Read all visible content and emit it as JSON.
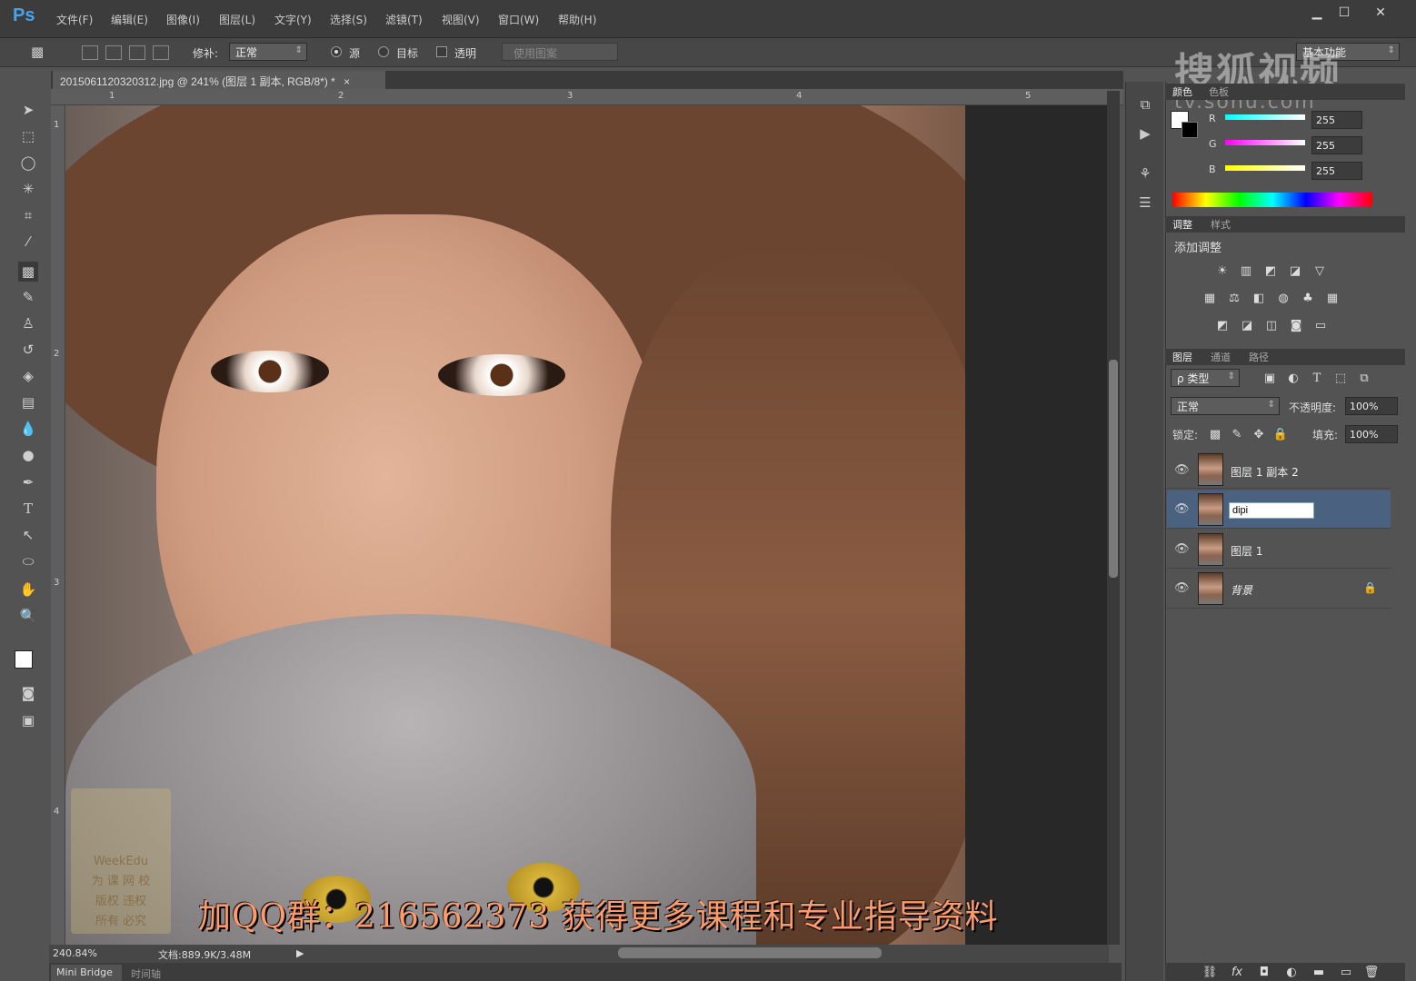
{
  "app": {
    "logo": "Ps"
  },
  "menu": [
    "文件(F)",
    "编辑(E)",
    "图像(I)",
    "图层(L)",
    "文字(Y)",
    "选择(S)",
    "滤镜(T)",
    "视图(V)",
    "窗口(W)",
    "帮助(H)"
  ],
  "window_controls": {
    "minimize": "▁",
    "maximize": "☐",
    "close": "✕"
  },
  "options": {
    "patch_label": "修补:",
    "patch_mode": "正常",
    "source_label": "源",
    "target_label": "目标",
    "transparent_label": "透明",
    "use_pattern_label": "使用图案",
    "workspace": "基本功能"
  },
  "document": {
    "tab_title": "2015061120320312.jpg @ 241% (图层 1 副本, RGB/8*) *",
    "tab_close": "×",
    "ruler_top": [
      "1",
      "2",
      "3",
      "4",
      "5"
    ],
    "ruler_left": [
      "1",
      "2",
      "3",
      "4"
    ],
    "overlay_text": "加QQ群：216562373 获得更多课程和专业指导资料",
    "weekedu_lines": [
      "WeekEdu",
      "为 课 网 校",
      "版权  违权",
      "所有  必究"
    ]
  },
  "status": {
    "zoom": "240.84%",
    "doc_size": "文档:889.9K/3.48M",
    "mini_bridge_tab": "Mini Bridge",
    "timeline_tab": "时间轴"
  },
  "watermark": {
    "sohu": "搜狐视频",
    "url": "tv.sohu.com"
  },
  "color_panel": {
    "tabs": [
      "颜色",
      "色板"
    ],
    "channels": [
      {
        "label": "R",
        "value": "255",
        "color": "#00e0ff"
      },
      {
        "label": "G",
        "value": "255",
        "color": "#ff40ff"
      },
      {
        "label": "B",
        "value": "255",
        "color": "#ffff20"
      }
    ]
  },
  "adjustments_panel": {
    "tabs": [
      "调整",
      "样式"
    ],
    "title": "添加调整",
    "row1": [
      "☀",
      "▥",
      "◩",
      "◪",
      "▽"
    ],
    "row2": [
      "▦",
      "⚖",
      "◧",
      "◍",
      "♣",
      "▦"
    ],
    "row3": [
      "◩",
      "◪",
      "◫",
      "◙",
      "▭"
    ]
  },
  "layers_panel": {
    "tabs": [
      "图层",
      "通道",
      "路径"
    ],
    "filter": "ρ 类型",
    "blend_mode": "正常",
    "opacity_label": "不透明度:",
    "opacity_value": "100%",
    "lock_label": "锁定:",
    "fill_label": "填充:",
    "fill_value": "100%",
    "layers": [
      {
        "name": "图层 1 副本 2",
        "selected": false
      },
      {
        "name": "",
        "selected": true,
        "editing_value": "dipi"
      },
      {
        "name": "图层 1",
        "selected": false
      },
      {
        "name": "背景",
        "selected": false,
        "locked": true
      }
    ],
    "footer_icons": [
      "⛓",
      "fx",
      "◘",
      "◐",
      "▬",
      "▭",
      "🗑"
    ]
  }
}
